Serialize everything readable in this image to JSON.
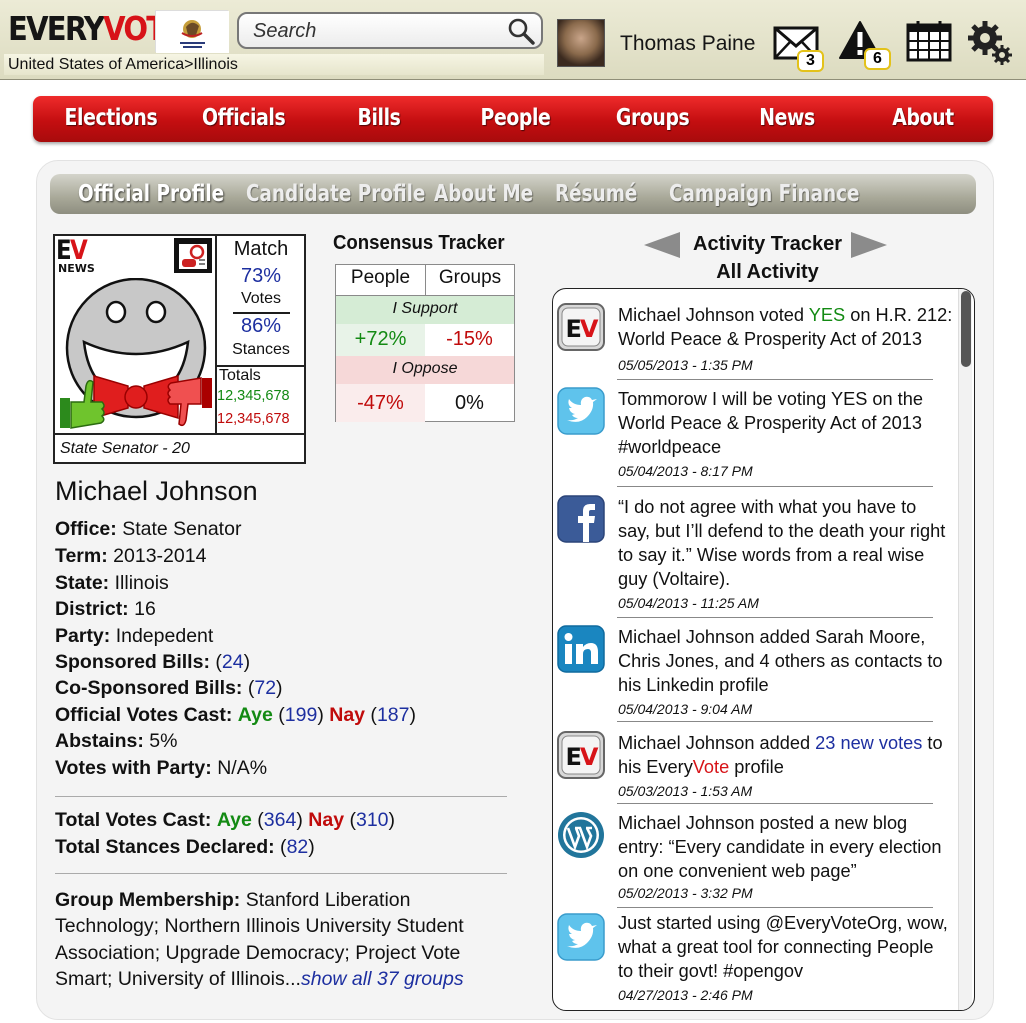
{
  "header": {
    "logo_part1": "EVERY",
    "logo_part2": "VOTE",
    "breadcrumb": "United States of America>Illinois",
    "search_placeholder": "Search",
    "user_name": "Thomas Paine",
    "messages_count": "3",
    "alerts_count": "6",
    "icons": [
      "illinois-flag",
      "search-icon",
      "avatar",
      "mail-icon",
      "alert-icon",
      "calendar-icon",
      "settings-icon"
    ]
  },
  "nav": [
    "Elections",
    "Officials",
    "Bills",
    "People",
    "Groups",
    "News",
    "About"
  ],
  "subtabs": [
    "Official Profile",
    "Candidate Profile",
    "About Me",
    "Résumé",
    "Campaign Finance"
  ],
  "card": {
    "ev_label": "EV",
    "news_label": "NEWS",
    "match_label": "Match",
    "votes_pct": "73%",
    "votes_label": "Votes",
    "stances_pct": "86%",
    "stances_label": "Stances",
    "totals_label": "Totals",
    "totals_green": "12,345,678",
    "totals_red": "12,345,678",
    "position": "State Senator - 20"
  },
  "consensus": {
    "title": "Consensus Tracker",
    "col_people": "People",
    "col_groups": "Groups",
    "support_label": "I Support",
    "support_people": "+72%",
    "support_groups": "-15%",
    "oppose_label": "I Oppose",
    "oppose_people": "-47%",
    "oppose_groups": "0%"
  },
  "profile": {
    "name": "Michael Johnson",
    "office_label": "Office:",
    "office": "State Senator",
    "term_label": "Term:",
    "term": "2013-2014",
    "state_label": "State:",
    "state": "Illinois",
    "district_label": "District:",
    "district": "16",
    "party_label": "Party:",
    "party": "Indepedent",
    "sponsored_label": "Sponsored Bills:",
    "sponsored": "24",
    "cosponsored_label": "Co-Sponsored Bills:",
    "cosponsored": "72",
    "votes_cast_label": "Official Votes Cast:",
    "aye_label": "Aye",
    "aye": "199",
    "nay_label": "Nay",
    "nay": "187",
    "abstains_label": "Abstains:",
    "abstains": "5%",
    "party_votes_label": "Votes with Party:",
    "party_votes": "N/A%",
    "total_votes_label": "Total Votes Cast:",
    "total_aye": "364",
    "total_nay": "310",
    "total_stances_label": "Total Stances Declared:",
    "total_stances": "82",
    "groups_label": "Group Membership:",
    "groups_text": "Stanford Liberation Technology; Northern Illinois University Student Association; Upgrade Democracy; Project Vote Smart; University of Illinois...",
    "groups_link": "show all 37 groups"
  },
  "activity": {
    "title": "Activity Tracker",
    "subtitle": "All Activity",
    "items": [
      {
        "icon": "everyvote-icon",
        "pre": "Michael Johnson voted ",
        "hl": "YES",
        "post": " on H.R. 212: World Peace & Prosperity Act of 2013",
        "date": "05/05/2013 - 1:35 PM"
      },
      {
        "icon": "twitter-icon",
        "pre": "Tommorow I will be voting YES on the World Peace & Prosperity Act of 2013 #worldpeace",
        "date": "05/04/2013 - 8:17 PM"
      },
      {
        "icon": "facebook-icon",
        "pre": "“I do not agree with what you have to say, but I’ll defend to the death your right to say it.” Wise words from a real wise guy (Voltaire).",
        "date": "05/04/2013 - 11:25 AM"
      },
      {
        "icon": "linkedin-icon",
        "pre": "Michael Johnson added Sarah Moore, Chris Jones, and 4 others as contacts to his Linkedin profile",
        "date": "05/04/2013 - 9:04 AM"
      },
      {
        "icon": "everyvote-icon",
        "pre": "Michael Johnson added ",
        "hl": "23 new votes",
        "post": " to his Every",
        "post2": "Vote",
        "post3": " profile",
        "date": "05/03/2013 - 1:53 AM"
      },
      {
        "icon": "wordpress-icon",
        "pre": "Michael Johnson posted a new blog entry: “Every candidate in every election on one convenient web page”",
        "date": "05/02/2013 - 3:32 PM"
      },
      {
        "icon": "twitter-icon",
        "pre": "Just started using @EveryVoteOrg, wow, what a great tool for connecting People to their govt! #opengov",
        "date": "04/27/2013 - 2:46 PM"
      }
    ]
  }
}
